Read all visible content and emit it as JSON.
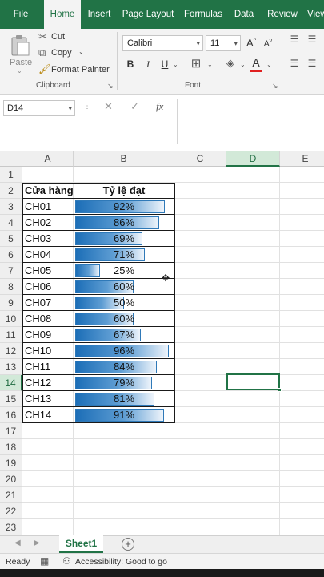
{
  "ribbon_tabs": [
    {
      "label": "File",
      "active": false
    },
    {
      "label": "Home",
      "active": true
    },
    {
      "label": "Insert",
      "active": false
    },
    {
      "label": "Page Layout",
      "active": false
    },
    {
      "label": "Formulas",
      "active": false
    },
    {
      "label": "Data",
      "active": false
    },
    {
      "label": "Review",
      "active": false
    },
    {
      "label": "View",
      "active": false
    }
  ],
  "clipboard": {
    "paste_label": "Paste",
    "cut_label": "Cut",
    "copy_label": "Copy",
    "format_painter_label": "Format Painter",
    "group_label": "Clipboard"
  },
  "font": {
    "font_name": "Calibri",
    "font_size": "11",
    "bold": "B",
    "italic": "I",
    "underline": "U",
    "grow": "A",
    "shrink": "A",
    "font_color_glyph": "A",
    "group_label": "Font",
    "font_color": "#e02020"
  },
  "formula_bar": {
    "name_box": "D14",
    "cancel_glyph": "✕",
    "enter_glyph": "✓",
    "fx_glyph": "fx",
    "value": ""
  },
  "columns": [
    "A",
    "B",
    "C",
    "D",
    "E"
  ],
  "selected_column": "D",
  "rows": [
    "1",
    "2",
    "3",
    "4",
    "5",
    "6",
    "7",
    "8",
    "9",
    "10",
    "11",
    "12",
    "13",
    "14",
    "15",
    "16",
    "17",
    "18",
    "19",
    "20",
    "21",
    "22",
    "23"
  ],
  "selected_row": "14",
  "table": {
    "header_store": "Cửa hàng",
    "header_rate": "Tỷ lệ đạt",
    "records": [
      {
        "store": "CH01",
        "rate": "92%",
        "value": 0.92
      },
      {
        "store": "CH02",
        "rate": "86%",
        "value": 0.86
      },
      {
        "store": "CH03",
        "rate": "69%",
        "value": 0.69
      },
      {
        "store": "CH04",
        "rate": "71%",
        "value": 0.71
      },
      {
        "store": "CH05",
        "rate": "25%",
        "value": 0.25
      },
      {
        "store": "CH06",
        "rate": "60%",
        "value": 0.6
      },
      {
        "store": "CH07",
        "rate": "50%",
        "value": 0.5
      },
      {
        "store": "CH08",
        "rate": "60%",
        "value": 0.6
      },
      {
        "store": "CH09",
        "rate": "67%",
        "value": 0.67
      },
      {
        "store": "CH10",
        "rate": "96%",
        "value": 0.96
      },
      {
        "store": "CH11",
        "rate": "84%",
        "value": 0.84
      },
      {
        "store": "CH12",
        "rate": "79%",
        "value": 0.79
      },
      {
        "store": "CH13",
        "rate": "81%",
        "value": 0.81
      },
      {
        "store": "CH14",
        "rate": "91%",
        "value": 0.91
      }
    ]
  },
  "sheet_tabs": [
    {
      "label": "Sheet1",
      "active": true
    }
  ],
  "add_sheet_glyph": "+",
  "status": {
    "ready": "Ready",
    "accessibility": "Accessibility: Good to go"
  },
  "colors": {
    "accent": "#217346",
    "databar_start": "#1c6eb7",
    "databar_border": "#2f79b8"
  }
}
